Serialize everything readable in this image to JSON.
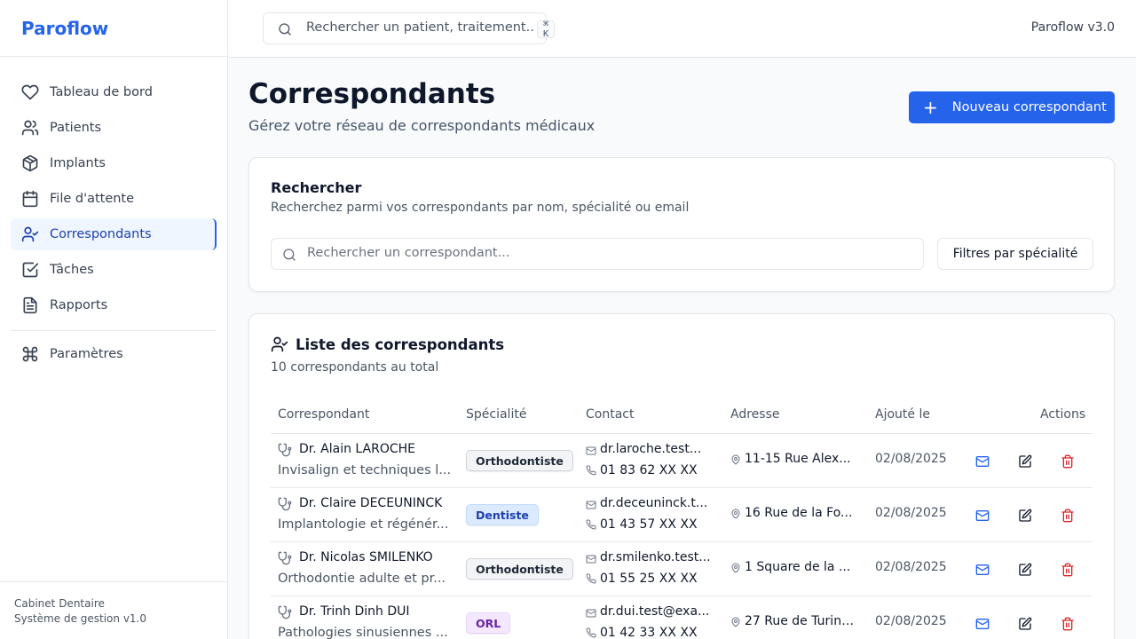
{
  "app": {
    "brand": "Paroflow",
    "version": "Paroflow v3.0"
  },
  "sidebar": {
    "items": [
      {
        "label": "Tableau de bord",
        "icon": "heart-icon"
      },
      {
        "label": "Patients",
        "icon": "users-icon"
      },
      {
        "label": "Implants",
        "icon": "box-icon"
      },
      {
        "label": "File d'attente",
        "icon": "calendar-icon"
      },
      {
        "label": "Correspondants",
        "icon": "user-check-icon",
        "active": true
      },
      {
        "label": "Tâches",
        "icon": "check-square-icon"
      },
      {
        "label": "Rapports",
        "icon": "file-text-icon"
      }
    ],
    "settings": {
      "label": "Paramètres",
      "icon": "command-icon"
    },
    "footer": {
      "line1": "Cabinet Dentaire",
      "line2": "Système de gestion v1.0"
    }
  },
  "topbar": {
    "search_placeholder": "Rechercher un patient, traitement...",
    "shortcut": "⌘ K"
  },
  "page": {
    "title": "Correspondants",
    "subtitle": "Gérez votre réseau de correspondants médicaux",
    "new_button": "Nouveau correspondant"
  },
  "search_card": {
    "title": "Rechercher",
    "description": "Recherchez parmi vos correspondants par nom, spécialité ou email",
    "placeholder": "Rechercher un correspondant...",
    "filter_button": "Filtres par spécialité"
  },
  "list": {
    "title": "Liste des correspondants",
    "count": "10 correspondants au total",
    "columns": [
      "Correspondant",
      "Spécialité",
      "Contact",
      "Adresse",
      "Ajouté le",
      "Actions"
    ],
    "rows": [
      {
        "name": "Dr. Alain LAROCHE",
        "desc": "Invisalign et techniques l...",
        "specialty": "Orthodontiste",
        "badge": "gray",
        "email": "dr.laroche.test...",
        "phone": "01 83 62 XX XX",
        "address": "11-15 Rue Alex...",
        "date": "02/08/2025"
      },
      {
        "name": "Dr. Claire DECEUNINCK",
        "desc": "Implantologie et régénér...",
        "specialty": "Dentiste",
        "badge": "blue",
        "email": "dr.deceuninck.t...",
        "phone": "01 43 57 XX XX",
        "address": "16 Rue de la Fo...",
        "date": "02/08/2025"
      },
      {
        "name": "Dr. Nicolas SMILENKO",
        "desc": "Orthodontie adulte et pr...",
        "specialty": "Orthodontiste",
        "badge": "gray",
        "email": "dr.smilenko.test...",
        "phone": "01 55 25 XX XX",
        "address": "1 Square de la ...",
        "date": "02/08/2025"
      },
      {
        "name": "Dr. Trinh Dinh DUI",
        "desc": "Pathologies sinusiennes ...",
        "specialty": "ORL",
        "badge": "purple",
        "email": "dr.dui.test@exa...",
        "phone": "01 42 33 XX XX",
        "address": "27 Rue de Turin,...",
        "date": "02/08/2025"
      }
    ]
  },
  "colors": {
    "accent": "#2563eb",
    "danger": "#dc2626"
  }
}
